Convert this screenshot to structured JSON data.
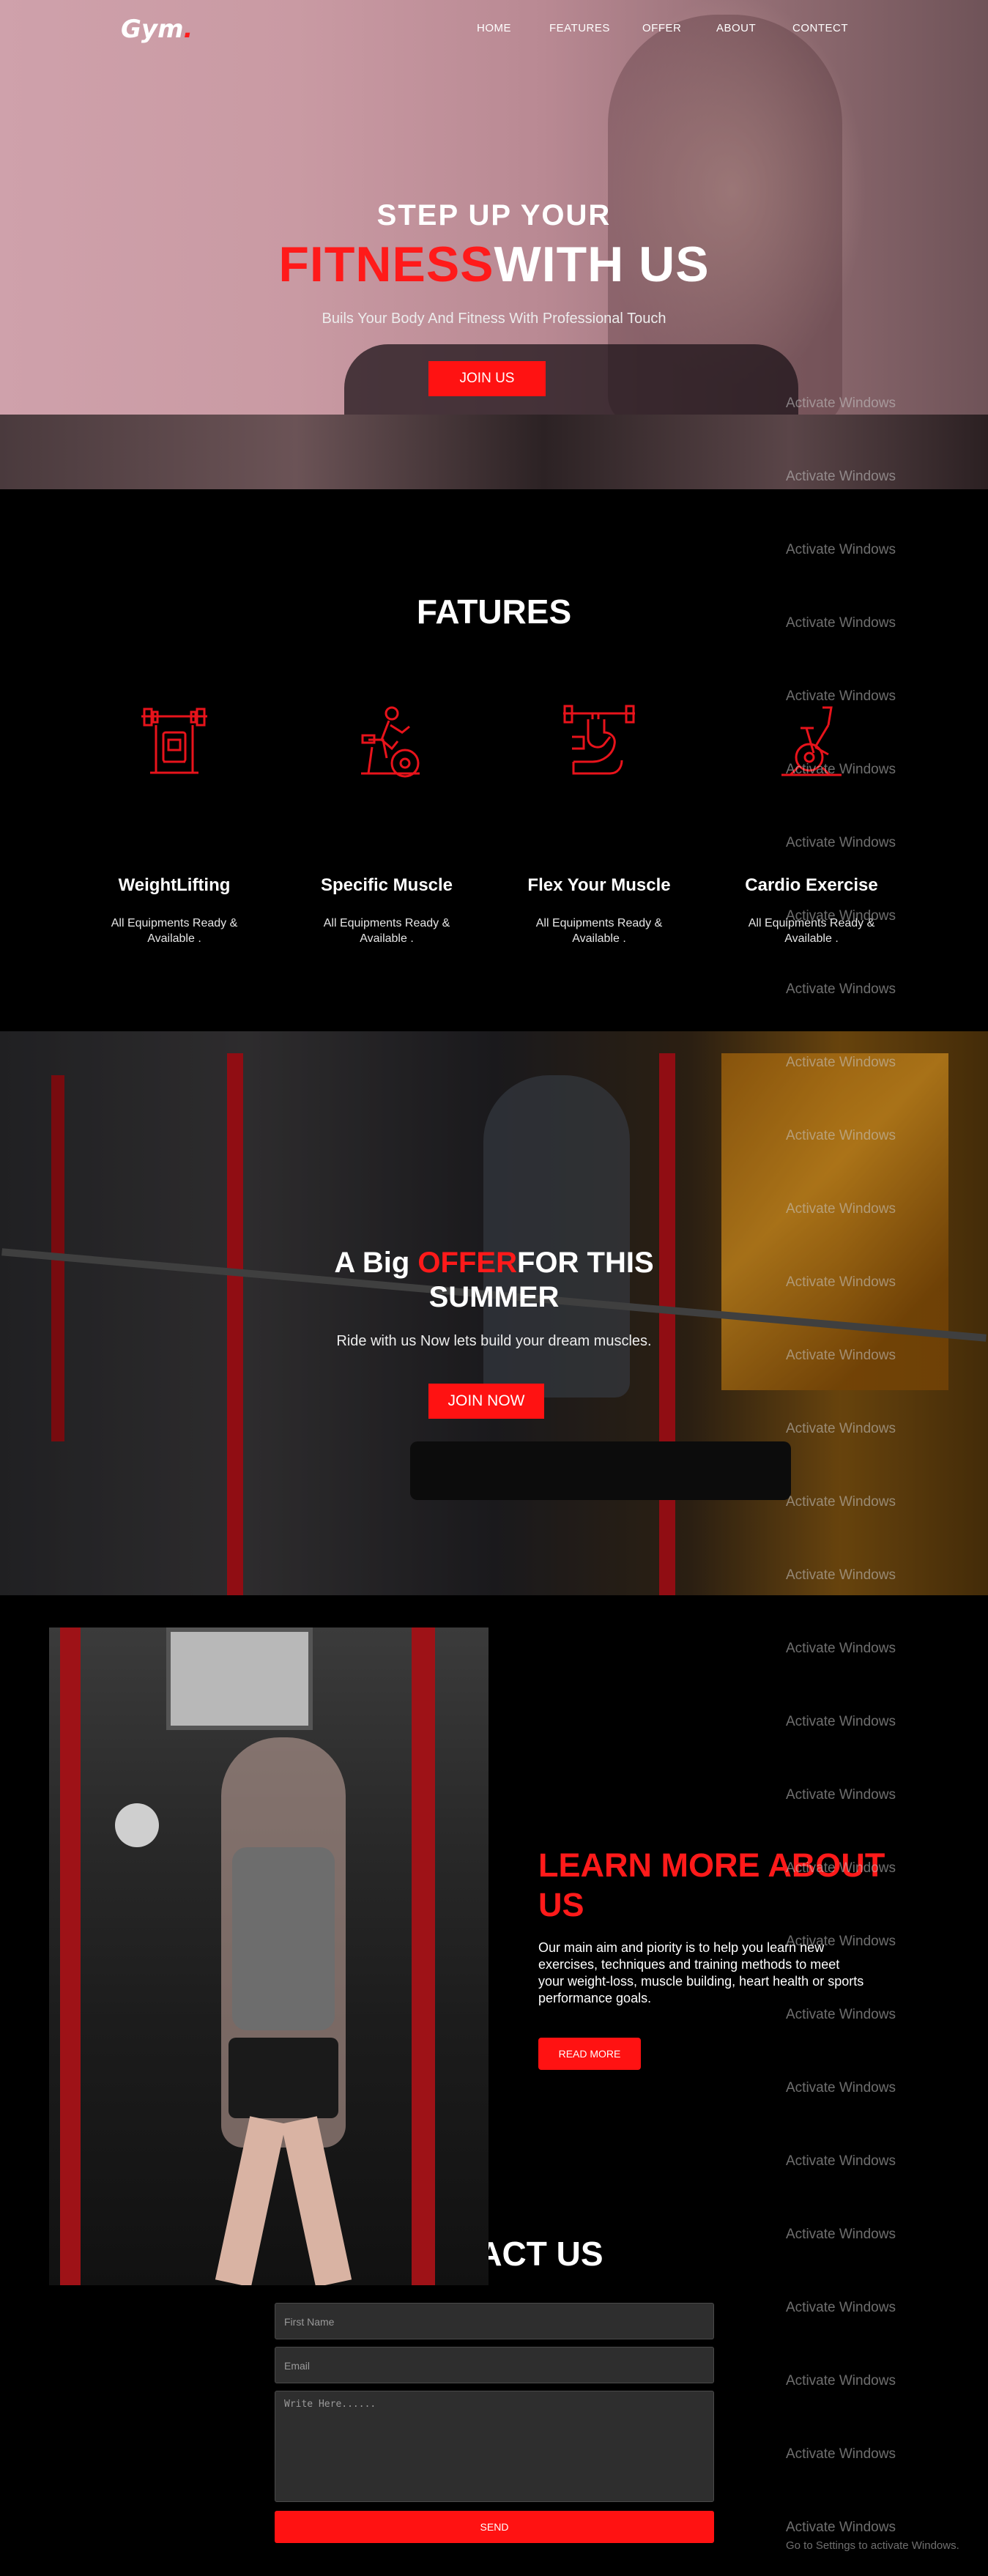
{
  "nav": {
    "logo": "Gym",
    "logo_dot": ".",
    "links": [
      "HOME",
      "FEATURES",
      "OFFER",
      "ABOUT",
      "CONTECT"
    ]
  },
  "hero": {
    "title_line1": "STEP UP YOUR",
    "title_red": "FITNESS",
    "title_white": "WITH US",
    "subtitle": "Buils Your Body And Fitness With Professional Touch",
    "button": "JOIN US"
  },
  "features": {
    "title": "FATURES",
    "items": [
      {
        "name": "WeightLifting",
        "desc": "All Equipments Ready & Available .",
        "icon": "weightlifting-icon"
      },
      {
        "name": "Specific Muscle",
        "desc": "All Equipments Ready & Available .",
        "icon": "exercise-bike-person-icon"
      },
      {
        "name": "Flex Your Muscle",
        "desc": "All Equipments Ready & Available .",
        "icon": "flex-muscle-icon"
      },
      {
        "name": "Cardio Exercise",
        "desc": "All Equipments Ready & Available .",
        "icon": "stationary-bike-icon"
      }
    ]
  },
  "offer": {
    "title_pre": "A Big ",
    "title_red": "OFFER",
    "title_post": "FOR THIS",
    "title_line2": "SUMMER",
    "subtitle": "Ride with us Now lets build your dream muscles.",
    "button": "JOIN NOW"
  },
  "about": {
    "title": "LEARN MORE ABOUT US",
    "text": "Our main aim and piority is to help you learn new exercises, techniques and training methods to meet your weight-loss, muscle building, heart health or sports performance goals.",
    "button": "READ MORE"
  },
  "contact": {
    "title": "CONTACT US",
    "first_name_placeholder": "First Name",
    "email_placeholder": "Email",
    "message_placeholder": "Write Here......",
    "button": "SEND"
  },
  "watermark": {
    "text": "Activate Windows",
    "sub": "Go to Settings to activate Windows."
  },
  "colors": {
    "accent": "#ff1a1a",
    "background": "#000000",
    "field": "#2e2e2e"
  }
}
